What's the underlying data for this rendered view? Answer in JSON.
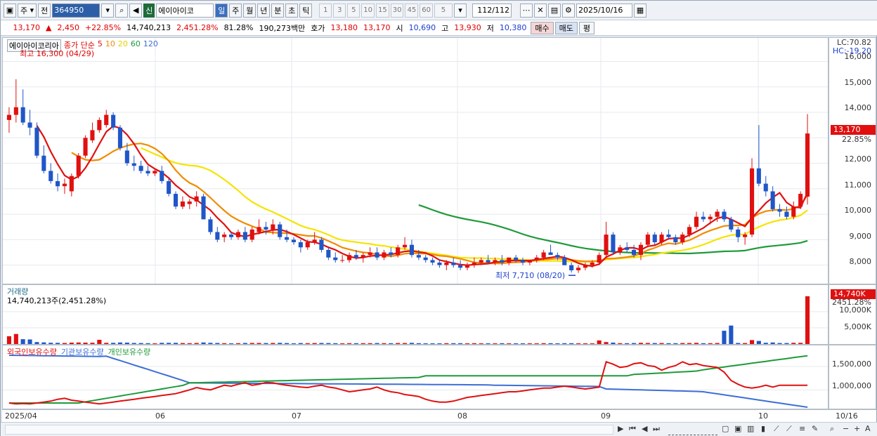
{
  "toolbar": {
    "market": "주",
    "market_type": "전",
    "code": "364950",
    "name_tag": "신",
    "name": "에이아이코",
    "periods": [
      "일",
      "주",
      "월",
      "년",
      "분",
      "초",
      "틱"
    ],
    "active_period": "일",
    "minute_nums": [
      "1",
      "3",
      "5",
      "10",
      "15",
      "30",
      "45",
      "60"
    ],
    "count_select": "5",
    "count": "112/112",
    "date": "2025/10/16"
  },
  "quote": {
    "price": "13,170",
    "change_arrow": "▲",
    "change": "2,450",
    "change_pct": "+22.85%",
    "volume": "14,740,213",
    "volume_pct": "2,451.28%",
    "rotation": "81.28%",
    "amount": "190,273백만",
    "hoga_label": "호가",
    "ask": "13,180",
    "bid": "13,170",
    "open_label": "시",
    "open": "10,690",
    "high_label": "고",
    "high": "13,930",
    "low_label": "저",
    "low": "10,380",
    "buy_label": "매수",
    "sell_label": "매도",
    "eval_label": "평"
  },
  "price_pane": {
    "stock_label": "에이아이코리아",
    "legend_prefix": "종가 단순",
    "ma_periods": [
      "5",
      "10",
      "20",
      "60",
      "120"
    ],
    "ma_colors": [
      "#e01010",
      "#f08c00",
      "#f5e400",
      "#1f9a3a",
      "#3d6fd6"
    ],
    "high_note": "최고 16,300 (04/29)",
    "low_note": "최저 7,710 (08/20)",
    "lc": "LC:70.82",
    "hc": "HC:-19.20",
    "y_ticks": [
      "16,000",
      "15,000",
      "14,000",
      "13,000",
      "12,000",
      "11,000",
      "10,000",
      "9,000",
      "8,000"
    ],
    "current_label": "13,170",
    "current_pct": "22.85%"
  },
  "volume_pane": {
    "title": "거래량",
    "summary": "14,740,213주(2,451.28%)",
    "y_ticks": [
      "10,000K",
      "5,000K"
    ],
    "current_label": "14,740K",
    "current_pct": "2451.28%"
  },
  "holdings_pane": {
    "legend": [
      "외국인보유수량",
      "기관보유수량",
      "개인보유수량"
    ],
    "colors": [
      "#e01010",
      "#3d6fd6",
      "#1f9a3a"
    ],
    "y_ticks": [
      "1,500,000",
      "1,000,000"
    ]
  },
  "x_axis": {
    "labels": [
      "2025/04",
      "06",
      "07",
      "08",
      "09",
      "10"
    ],
    "end_label": "10/16"
  },
  "chart_data": {
    "type": "candlestick",
    "title": "에이아이코리아",
    "ylim": [
      7500,
      16300
    ],
    "candles": [
      [
        13700,
        14200,
        13200,
        13900
      ],
      [
        13900,
        15300,
        13600,
        14200
      ],
      [
        14200,
        14900,
        13500,
        13600
      ],
      [
        13600,
        14100,
        13100,
        13400
      ],
      [
        13400,
        13600,
        12200,
        12300
      ],
      [
        12300,
        12700,
        11600,
        11700
      ],
      [
        11700,
        12000,
        11200,
        11300
      ],
      [
        11300,
        11600,
        10900,
        11100
      ],
      [
        11100,
        11400,
        10800,
        11200
      ],
      [
        10900,
        11600,
        10700,
        11500
      ],
      [
        11500,
        12400,
        11400,
        12300
      ],
      [
        12300,
        13100,
        12200,
        13000
      ],
      [
        12900,
        13600,
        12800,
        13300
      ],
      [
        13300,
        13800,
        13200,
        13700
      ],
      [
        13500,
        14100,
        13400,
        13900
      ],
      [
        13900,
        14000,
        13300,
        13400
      ],
      [
        13400,
        13500,
        12500,
        12600
      ],
      [
        12500,
        12800,
        11900,
        12000
      ],
      [
        12000,
        12300,
        11700,
        11900
      ],
      [
        11900,
        12100,
        11600,
        11700
      ],
      [
        11700,
        11900,
        11500,
        11600
      ],
      [
        11600,
        11800,
        11500,
        11700
      ],
      [
        11700,
        11900,
        11200,
        11300
      ],
      [
        11300,
        11400,
        10700,
        10800
      ],
      [
        10800,
        10900,
        10200,
        10300
      ],
      [
        10300,
        10700,
        10200,
        10500
      ],
      [
        10400,
        10600,
        10200,
        10500
      ],
      [
        10500,
        10900,
        10300,
        10700
      ],
      [
        10700,
        10800,
        9800,
        9800
      ],
      [
        9800,
        9900,
        9200,
        9300
      ],
      [
        9300,
        9500,
        8900,
        9000
      ],
      [
        9100,
        9300,
        8900,
        9200
      ],
      [
        9200,
        9300,
        9000,
        9100
      ],
      [
        9100,
        9400,
        9000,
        9300
      ],
      [
        9300,
        9500,
        8900,
        9000
      ],
      [
        9000,
        9500,
        8900,
        9400
      ],
      [
        9300,
        9800,
        9200,
        9500
      ],
      [
        9500,
        9700,
        9200,
        9400
      ],
      [
        9400,
        9800,
        9200,
        9600
      ],
      [
        9600,
        9700,
        9000,
        9100
      ],
      [
        9100,
        9400,
        8900,
        9000
      ],
      [
        9000,
        9100,
        8800,
        8900
      ],
      [
        8900,
        9000,
        8500,
        8700
      ],
      [
        8700,
        9000,
        8600,
        8900
      ],
      [
        8900,
        9300,
        8800,
        9000
      ],
      [
        9000,
        9100,
        8500,
        8600
      ],
      [
        8600,
        8700,
        8200,
        8300
      ],
      [
        8300,
        8500,
        8100,
        8200
      ],
      [
        8200,
        8400,
        8100,
        8200
      ],
      [
        8200,
        8500,
        8100,
        8400
      ],
      [
        8400,
        8600,
        8200,
        8300
      ],
      [
        8300,
        8500,
        8100,
        8400
      ],
      [
        8400,
        8700,
        8300,
        8500
      ],
      [
        8500,
        8700,
        8200,
        8300
      ],
      [
        8300,
        8600,
        8200,
        8500
      ],
      [
        8500,
        8700,
        8300,
        8400
      ],
      [
        8400,
        8800,
        8300,
        8700
      ],
      [
        8700,
        9100,
        8600,
        8800
      ],
      [
        8800,
        9000,
        8300,
        8400
      ],
      [
        8400,
        8600,
        8200,
        8300
      ],
      [
        8300,
        8400,
        8100,
        8200
      ],
      [
        8200,
        8300,
        8000,
        8100
      ],
      [
        8100,
        8200,
        7900,
        8000
      ],
      [
        8000,
        8200,
        7800,
        8100
      ],
      [
        8100,
        8300,
        7900,
        8000
      ],
      [
        8000,
        8200,
        7800,
        7900
      ],
      [
        7900,
        8100,
        7800,
        8000
      ],
      [
        8000,
        8300,
        7900,
        8100
      ],
      [
        8100,
        8300,
        8000,
        8200
      ],
      [
        8200,
        8400,
        8100,
        8100
      ],
      [
        8100,
        8300,
        8000,
        8200
      ],
      [
        8200,
        8400,
        8000,
        8100
      ],
      [
        8100,
        8300,
        8000,
        8300
      ],
      [
        8300,
        8400,
        8100,
        8200
      ],
      [
        8200,
        8300,
        8000,
        8100
      ],
      [
        8100,
        8200,
        8000,
        8200
      ],
      [
        8200,
        8400,
        8100,
        8300
      ],
      [
        8300,
        8600,
        8200,
        8500
      ],
      [
        8500,
        8800,
        8400,
        8400
      ],
      [
        8400,
        8500,
        8200,
        8300
      ],
      [
        8300,
        8400,
        8000,
        8000
      ],
      [
        8000,
        8100,
        7710,
        7800
      ],
      [
        7800,
        8000,
        7700,
        7900
      ],
      [
        7900,
        8100,
        7800,
        8000
      ],
      [
        8000,
        8200,
        7900,
        8100
      ],
      [
        8100,
        8500,
        8000,
        8400
      ],
      [
        8400,
        9700,
        8300,
        9200
      ],
      [
        9200,
        9300,
        8400,
        8500
      ],
      [
        8500,
        8800,
        8400,
        8700
      ],
      [
        8700,
        8900,
        8500,
        8600
      ],
      [
        8600,
        8800,
        8300,
        8400
      ],
      [
        8400,
        8900,
        8200,
        8800
      ],
      [
        8800,
        9300,
        8700,
        9200
      ],
      [
        9200,
        9300,
        8800,
        8900
      ],
      [
        8900,
        9300,
        8800,
        9200
      ],
      [
        9200,
        9400,
        9000,
        9100
      ],
      [
        9100,
        9200,
        8800,
        8900
      ],
      [
        8900,
        9300,
        8800,
        9200
      ],
      [
        9200,
        9600,
        9100,
        9500
      ],
      [
        9500,
        10100,
        9400,
        9900
      ],
      [
        9900,
        10100,
        9700,
        9800
      ],
      [
        9800,
        10000,
        9600,
        9900
      ],
      [
        9900,
        10200,
        9700,
        10100
      ],
      [
        10100,
        10200,
        9700,
        9800
      ],
      [
        9800,
        9900,
        9300,
        9400
      ],
      [
        9400,
        9500,
        8900,
        9100
      ],
      [
        9100,
        9300,
        8800,
        9200
      ],
      [
        9200,
        12200,
        9100,
        11800
      ],
      [
        11800,
        13500,
        11100,
        11200
      ],
      [
        11200,
        11500,
        10700,
        10900
      ],
      [
        10900,
        11100,
        10100,
        10200
      ],
      [
        10200,
        10400,
        9900,
        10100
      ],
      [
        10100,
        10300,
        9800,
        9900
      ],
      [
        9900,
        10500,
        9800,
        10300
      ],
      [
        10300,
        10900,
        10200,
        10800
      ],
      [
        10690,
        13930,
        10380,
        13170
      ]
    ]
  }
}
